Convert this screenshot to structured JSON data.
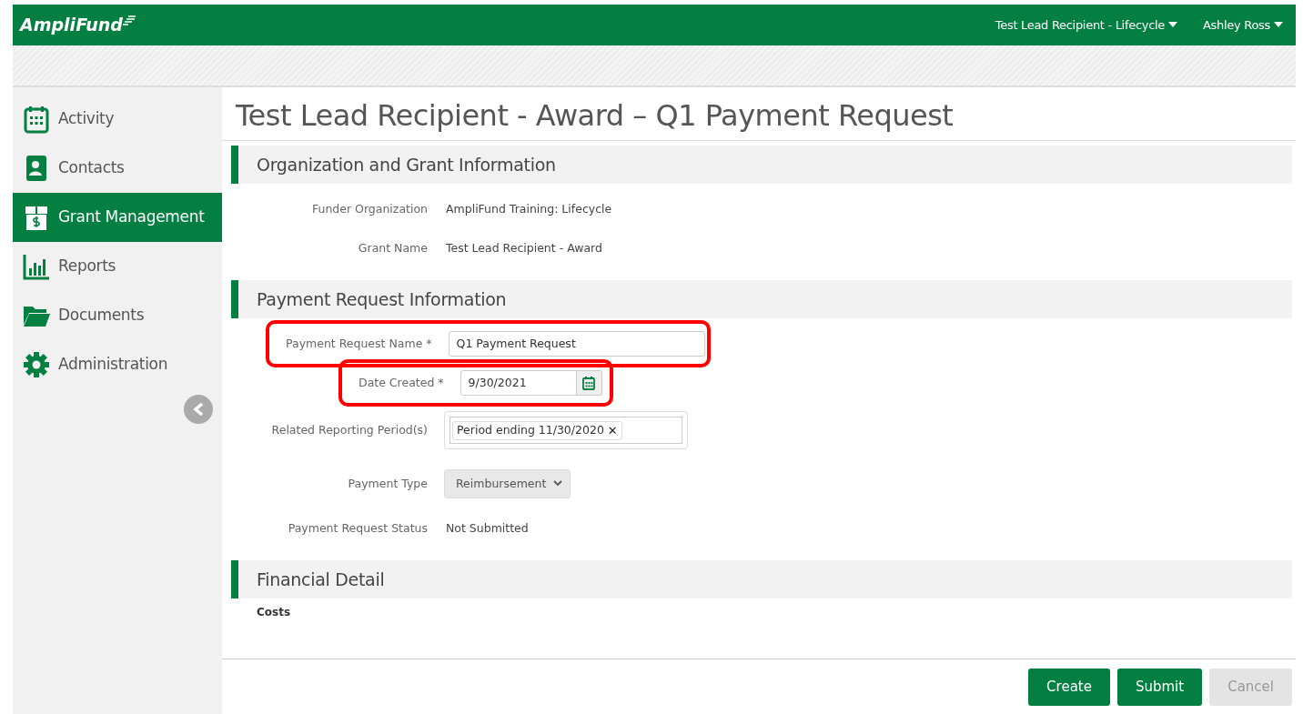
{
  "brand": "AmpliFund",
  "top_menus": [
    {
      "label": "Test Lead Recipient - Lifecycle"
    },
    {
      "label": "Ashley Ross"
    }
  ],
  "sidebar": {
    "items": [
      {
        "label": "Activity",
        "selected": false
      },
      {
        "label": "Contacts",
        "selected": false
      },
      {
        "label": "Grant Management",
        "selected": true
      },
      {
        "label": "Reports",
        "selected": false
      },
      {
        "label": "Documents",
        "selected": false
      },
      {
        "label": "Administration",
        "selected": false
      }
    ]
  },
  "page_title": "Test Lead Recipient - Award – Q1 Payment Request",
  "sections": [
    {
      "title": "Organization and Grant Information",
      "fields": [
        {
          "kind": "text",
          "label": "Funder Organization",
          "value": "AmpliFund Training: Lifecycle",
          "highlighted": false
        },
        {
          "kind": "text",
          "label": "Grant Name",
          "value": "Test Lead Recipient - Award",
          "highlighted": false
        }
      ]
    },
    {
      "title": "Payment Request Information",
      "fields": [
        {
          "kind": "input",
          "label": "Payment Request Name *",
          "value": "Q1 Payment Request",
          "highlighted": true
        },
        {
          "kind": "date",
          "label": "Date Created *",
          "value": "9/30/2021",
          "highlighted": true
        },
        {
          "kind": "tags",
          "label": "Related Reporting Period(s)",
          "tags": [
            {
              "label": "Period ending 11/30/2020",
              "remove": "✕"
            }
          ],
          "highlighted": false
        },
        {
          "kind": "select",
          "label": "Payment Type",
          "value": "Reimbursement",
          "highlighted": false
        },
        {
          "kind": "text",
          "label": "Payment Request Status",
          "value": "Not Submitted",
          "highlighted": false
        }
      ]
    },
    {
      "title": "Financial Detail",
      "subheading": "Costs"
    }
  ],
  "buttons": [
    {
      "label": "Create",
      "disabled": false
    },
    {
      "label": "Submit",
      "disabled": false
    },
    {
      "label": "Cancel",
      "disabled": true
    }
  ]
}
